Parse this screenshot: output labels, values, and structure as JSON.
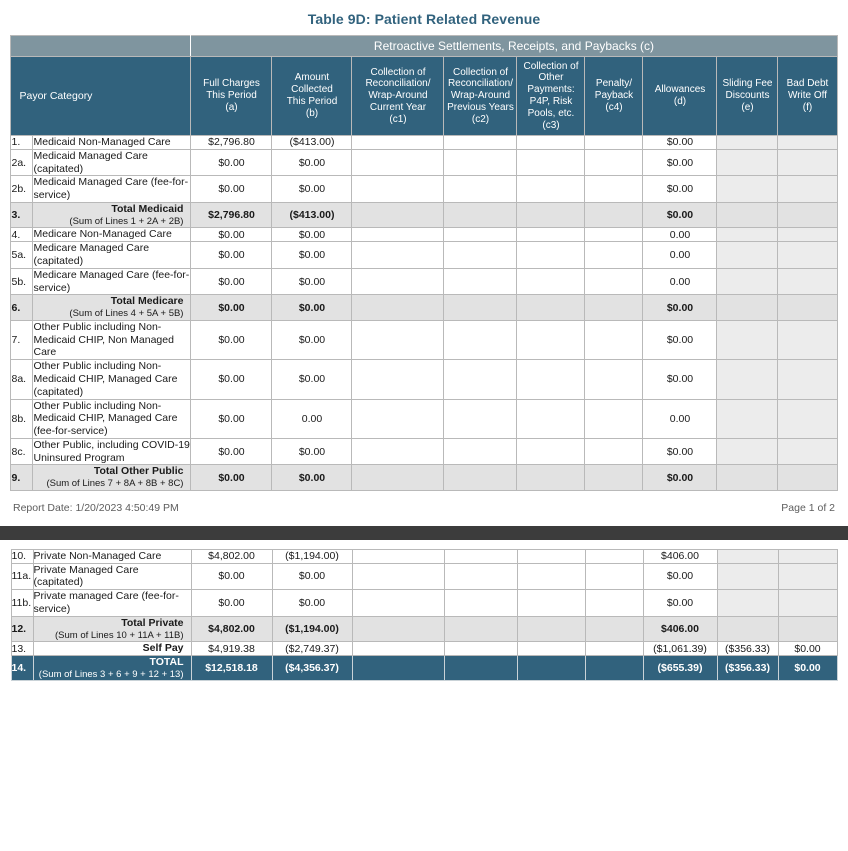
{
  "report": {
    "title": "Table 9D: Patient Related Revenue",
    "band_label": "Retroactive Settlements, Receipts, and Paybacks (c)",
    "report_date_label": "Report Date: 1/20/2023 4:50:49 PM",
    "page_label": "Page 1 of 2"
  },
  "colors": {
    "header_dark": "#31627d",
    "band_slate": "#7f959f",
    "title_blue": "#31627d",
    "subtotal_gray": "#e2e2e2",
    "empty_gray": "#ececec",
    "page_separator": "#3c3c3c"
  },
  "columns": [
    {
      "id": "num",
      "label": ""
    },
    {
      "id": "payor",
      "label": "Payor Category"
    },
    {
      "id": "a",
      "label": "Full Charges This Period",
      "code": "(a)"
    },
    {
      "id": "b",
      "label": "Amount Collected This Period",
      "code": "(b)"
    },
    {
      "id": "c1",
      "label": "Collection of Reconciliation/ Wrap-Around Current Year",
      "code": "(c1)"
    },
    {
      "id": "c2",
      "label": "Collection of Reconciliation/ Wrap-Around Previous Years",
      "code": "(c2)"
    },
    {
      "id": "c3",
      "label": "Collection of Other Payments: P4P, Risk Pools, etc.",
      "code": "(c3)"
    },
    {
      "id": "c4",
      "label": "Penalty/ Payback",
      "code": "(c4)"
    },
    {
      "id": "d",
      "label": "Allowances",
      "code": "(d)"
    },
    {
      "id": "e",
      "label": "Sliding Fee Discounts",
      "code": "(e)"
    },
    {
      "id": "f",
      "label": "Bad Debt Write Off",
      "code": "(f)"
    }
  ],
  "header_cells": {
    "payor": "Payor Category",
    "a_l1": "Full Charges",
    "a_l2": "This Period",
    "a_l3": "(a)",
    "b_l1": "Amount",
    "b_l2": "Collected",
    "b_l3": "This Period",
    "b_l4": "(b)",
    "c1_l1": "Collection of",
    "c1_l2": "Reconciliation/",
    "c1_l3": "Wrap-Around",
    "c1_l4": "Current Year",
    "c1_l5": "(c1)",
    "c2_l1": "Collection of",
    "c2_l2": "Reconciliation/",
    "c2_l3": "Wrap-Around",
    "c2_l4": "Previous Years",
    "c2_l5": "(c2)",
    "c3_l1": "Collection of",
    "c3_l2": "Other",
    "c3_l3": "Payments:",
    "c3_l4": "P4P, Risk",
    "c3_l5": "Pools, etc.",
    "c3_l6": "(c3)",
    "c4_l1": "Penalty/",
    "c4_l2": "Payback",
    "c4_l3": "(c4)",
    "d_l1": "Allowances",
    "d_l2": "(d)",
    "e_l1": "Sliding Fee",
    "e_l2": "Discounts",
    "e_l3": "(e)",
    "f_l1": "Bad Debt",
    "f_l2": "Write Off",
    "f_l3": "(f)"
  },
  "page1_rows": [
    {
      "num": "1.",
      "label": "Medicaid Non-Managed Care",
      "note": "",
      "type": "data",
      "a": "$2,796.80",
      "b": "($413.00)",
      "c1": "",
      "c2": "",
      "c3": "",
      "c4": "",
      "d": "$0.00",
      "e": "",
      "f": ""
    },
    {
      "num": "2a.",
      "label": "Medicaid Managed Care (capitated)",
      "note": "",
      "type": "data",
      "a": "$0.00",
      "b": "$0.00",
      "c1": "",
      "c2": "",
      "c3": "",
      "c4": "",
      "d": "$0.00",
      "e": "",
      "f": ""
    },
    {
      "num": "2b.",
      "label": "Medicaid Managed Care (fee-for-service)",
      "note": "",
      "type": "data",
      "a": "$0.00",
      "b": "$0.00",
      "c1": "",
      "c2": "",
      "c3": "",
      "c4": "",
      "d": "$0.00",
      "e": "",
      "f": ""
    },
    {
      "num": "3.",
      "label": "Total Medicaid",
      "note": "(Sum of Lines 1 + 2A + 2B)",
      "type": "subtotal",
      "a": "$2,796.80",
      "b": "($413.00)",
      "c1": "",
      "c2": "",
      "c3": "",
      "c4": "",
      "d": "$0.00",
      "e": "",
      "f": ""
    },
    {
      "num": "4.",
      "label": "Medicare Non-Managed Care",
      "note": "",
      "type": "data",
      "a": "$0.00",
      "b": "$0.00",
      "c1": "",
      "c2": "",
      "c3": "",
      "c4": "",
      "d": "0.00",
      "e": "",
      "f": ""
    },
    {
      "num": "5a.",
      "label": "Medicare Managed Care (capitated)",
      "note": "",
      "type": "data",
      "a": "$0.00",
      "b": "$0.00",
      "c1": "",
      "c2": "",
      "c3": "",
      "c4": "",
      "d": "0.00",
      "e": "",
      "f": ""
    },
    {
      "num": "5b.",
      "label": "Medicare Managed Care (fee-for-service)",
      "note": "",
      "type": "data",
      "a": "$0.00",
      "b": "$0.00",
      "c1": "",
      "c2": "",
      "c3": "",
      "c4": "",
      "d": "0.00",
      "e": "",
      "f": ""
    },
    {
      "num": "6.",
      "label": "Total Medicare",
      "note": "(Sum of Lines 4 + 5A + 5B)",
      "type": "subtotal",
      "a": "$0.00",
      "b": "$0.00",
      "c1": "",
      "c2": "",
      "c3": "",
      "c4": "",
      "d": "$0.00",
      "e": "",
      "f": ""
    },
    {
      "num": "7.",
      "label": "Other Public including Non-Medicaid CHIP, Non Managed Care",
      "note": "",
      "type": "data",
      "a": "$0.00",
      "b": "$0.00",
      "c1": "",
      "c2": "",
      "c3": "",
      "c4": "",
      "d": "$0.00",
      "e": "",
      "f": ""
    },
    {
      "num": "8a.",
      "label": "Other Public including Non-Medicaid CHIP, Managed Care  (capitated)",
      "note": "",
      "type": "data",
      "a": "$0.00",
      "b": "$0.00",
      "c1": "",
      "c2": "",
      "c3": "",
      "c4": "",
      "d": "$0.00",
      "e": "",
      "f": ""
    },
    {
      "num": "8b.",
      "label": "Other Public including Non-Medicaid CHIP,  Managed Care (fee-for-service)",
      "note": "",
      "type": "data",
      "a": "$0.00",
      "b": "0.00",
      "c1": "",
      "c2": "",
      "c3": "",
      "c4": "",
      "d": "0.00",
      "e": "",
      "f": ""
    },
    {
      "num": "8c.",
      "label": "Other Public, including COVID-19 Uninsured Program",
      "note": "",
      "type": "data",
      "a": "$0.00",
      "b": "$0.00",
      "c1": "",
      "c2": "",
      "c3": "",
      "c4": "",
      "d": "$0.00",
      "e": "",
      "f": ""
    },
    {
      "num": "9.",
      "label": "Total Other Public",
      "note": "(Sum of Lines 7 + 8A + 8B + 8C)",
      "type": "subtotal",
      "a": "$0.00",
      "b": "$0.00",
      "c1": "",
      "c2": "",
      "c3": "",
      "c4": "",
      "d": "$0.00",
      "e": "",
      "f": ""
    }
  ],
  "page2_rows": [
    {
      "num": "10.",
      "label": "Private Non-Managed Care",
      "note": "",
      "type": "data",
      "a": "$4,802.00",
      "b": "($1,194.00)",
      "c1": "",
      "c2": "",
      "c3": "",
      "c4": "",
      "d": "$406.00",
      "e": "",
      "f": ""
    },
    {
      "num": "11a.",
      "label": "Private Managed Care (capitated)",
      "note": "",
      "type": "data",
      "a": "$0.00",
      "b": "$0.00",
      "c1": "",
      "c2": "",
      "c3": "",
      "c4": "",
      "d": "$0.00",
      "e": "",
      "f": ""
    },
    {
      "num": "11b.",
      "label": "Private managed Care (fee-for-service)",
      "note": "",
      "type": "data",
      "a": "$0.00",
      "b": "$0.00",
      "c1": "",
      "c2": "",
      "c3": "",
      "c4": "",
      "d": "$0.00",
      "e": "",
      "f": ""
    },
    {
      "num": "12.",
      "label": "Total Private",
      "note": "(Sum of Lines 10 + 11A + 11B)",
      "type": "subtotal",
      "a": "$4,802.00",
      "b": "($1,194.00)",
      "c1": "",
      "c2": "",
      "c3": "",
      "c4": "",
      "d": "$406.00",
      "e": "",
      "f": ""
    },
    {
      "num": "13.",
      "label": "Self Pay",
      "note": "",
      "type": "rightlabel",
      "a": "$4,919.38",
      "b": "($2,749.37)",
      "c1": "",
      "c2": "",
      "c3": "",
      "c4": "",
      "d": "($1,061.39)",
      "e": "($356.33)",
      "f": "$0.00"
    },
    {
      "num": "14.",
      "label": "TOTAL",
      "note": "(Sum of Lines 3 + 6 + 9 + 12 + 13)",
      "type": "grand",
      "a": "$12,518.18",
      "b": "($4,356.37)",
      "c1": "",
      "c2": "",
      "c3": "",
      "c4": "",
      "d": "($655.39)",
      "e": "($356.33)",
      "f": "$0.00"
    }
  ]
}
